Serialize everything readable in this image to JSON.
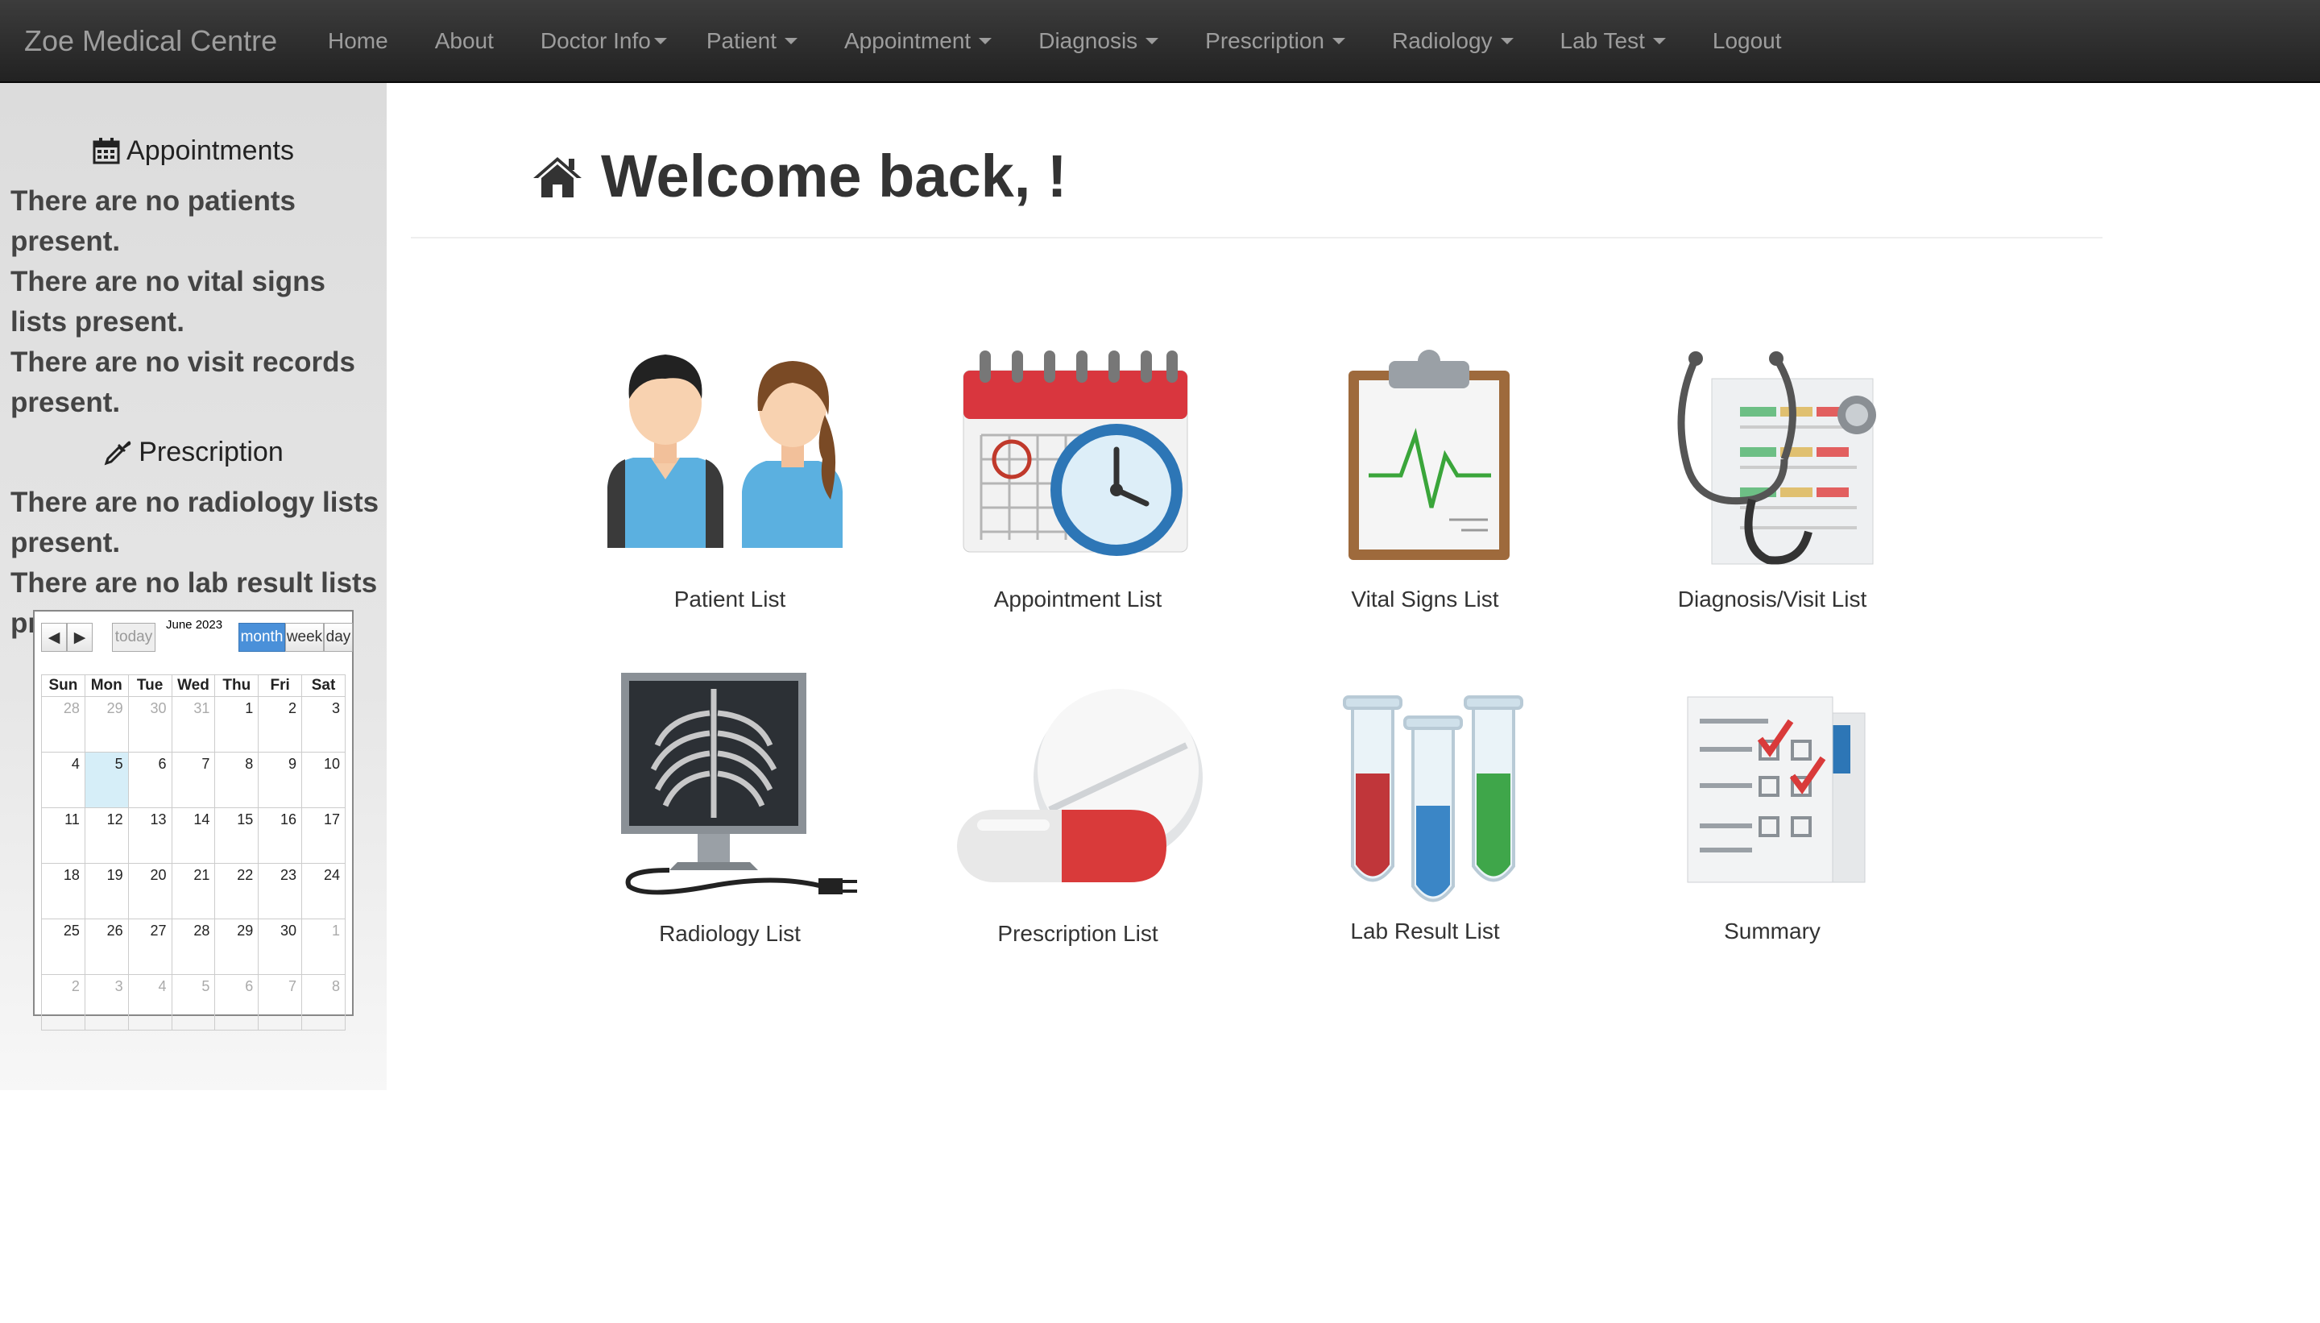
{
  "navbar": {
    "brand": "Zoe Medical Centre",
    "items": [
      {
        "label": "Home",
        "dropdown": false
      },
      {
        "label": "About",
        "dropdown": false
      },
      {
        "label": "Doctor Info",
        "dropdown": true
      },
      {
        "label": "Patient",
        "dropdown": true
      },
      {
        "label": "Appointment",
        "dropdown": true
      },
      {
        "label": "Diagnosis",
        "dropdown": true
      },
      {
        "label": "Prescription",
        "dropdown": true
      },
      {
        "label": "Radiology",
        "dropdown": true
      },
      {
        "label": "Lab Test",
        "dropdown": true
      },
      {
        "label": "Logout",
        "dropdown": false
      }
    ]
  },
  "sidebar": {
    "appointments_heading": "Appointments",
    "messages_1": [
      "There are no patients present.",
      "There are no vital signs lists present.",
      "There are no visit records present."
    ],
    "prescription_heading": "Prescription",
    "messages_2": [
      "There are no radiology lists present.",
      "There are no lab result lists present."
    ]
  },
  "calendar": {
    "title": "June 2023",
    "today_label": "today",
    "view_month": "month",
    "view_week": "week",
    "view_day": "day",
    "active_view": "month",
    "weekdays": [
      "Sun",
      "Mon",
      "Tue",
      "Wed",
      "Thu",
      "Fri",
      "Sat"
    ],
    "weeks": [
      [
        "28",
        "29",
        "30",
        "31",
        "1",
        "2",
        "3"
      ],
      [
        "4",
        "5",
        "6",
        "7",
        "8",
        "9",
        "10"
      ],
      [
        "11",
        "12",
        "13",
        "14",
        "15",
        "16",
        "17"
      ],
      [
        "18",
        "19",
        "20",
        "21",
        "22",
        "23",
        "24"
      ],
      [
        "25",
        "26",
        "27",
        "28",
        "29",
        "30",
        "1"
      ],
      [
        "2",
        "3",
        "4",
        "5",
        "6",
        "7",
        "8"
      ]
    ],
    "today": "5"
  },
  "main": {
    "welcome": "Welcome back, !",
    "tiles": [
      {
        "label": "Patient List",
        "icon": "patients-icon"
      },
      {
        "label": "Appointment List",
        "icon": "calendar-clock-icon"
      },
      {
        "label": "Vital Signs List",
        "icon": "clipboard-heartbeat-icon"
      },
      {
        "label": "Diagnosis/Visit List",
        "icon": "stethoscope-chart-icon"
      },
      {
        "label": "Radiology List",
        "icon": "xray-monitor-icon"
      },
      {
        "label": "Prescription List",
        "icon": "pills-icon"
      },
      {
        "label": "Lab Result List",
        "icon": "test-tubes-icon"
      },
      {
        "label": "Summary",
        "icon": "checklist-icon"
      }
    ]
  },
  "colors": {
    "navbar_bg": "#222222",
    "nav_text": "#9d9d9d",
    "calendar_active": "#4a90d9",
    "today_highlight": "#d6eef8"
  }
}
